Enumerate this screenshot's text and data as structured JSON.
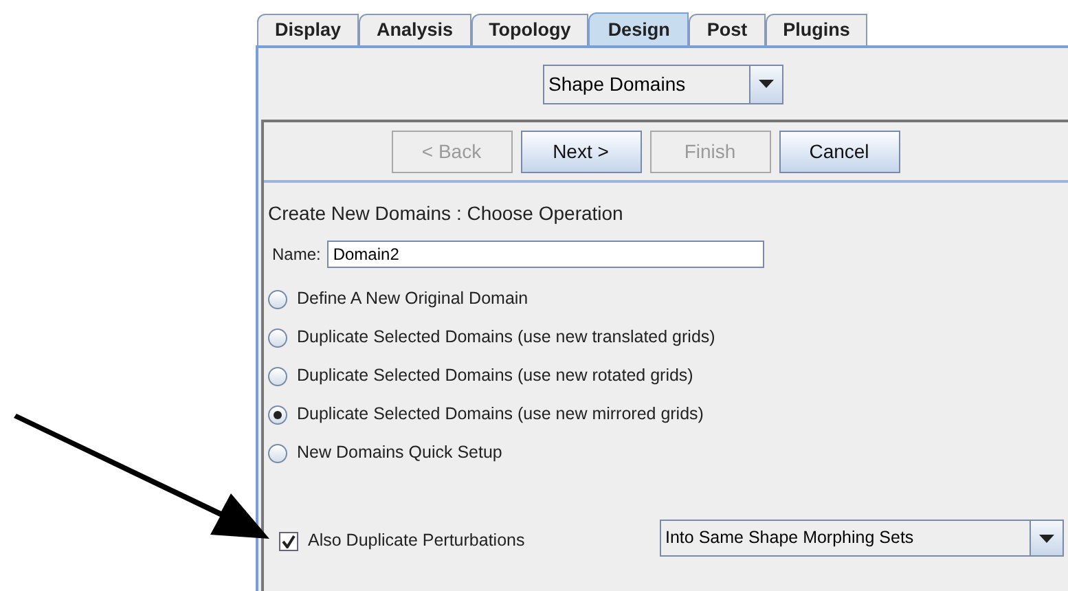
{
  "tabs": [
    {
      "label": "Display",
      "selected": false
    },
    {
      "label": "Analysis",
      "selected": false
    },
    {
      "label": "Topology",
      "selected": false
    },
    {
      "label": "Design",
      "selected": true
    },
    {
      "label": "Post",
      "selected": false
    },
    {
      "label": "Plugins",
      "selected": false
    }
  ],
  "mode_select": {
    "value": "Shape Domains"
  },
  "wizard_buttons": [
    {
      "label": "< Back",
      "disabled": true
    },
    {
      "label": "Next >",
      "disabled": false
    },
    {
      "label": "Finish",
      "disabled": true
    },
    {
      "label": "Cancel",
      "disabled": false
    }
  ],
  "heading": "Create New Domains : Choose Operation",
  "name_field": {
    "label": "Name:",
    "value": "Domain2"
  },
  "options": [
    {
      "label": "Define A New Original Domain",
      "selected": false
    },
    {
      "label": "Duplicate Selected Domains (use new translated grids)",
      "selected": false
    },
    {
      "label": "Duplicate Selected Domains (use new rotated grids)",
      "selected": false
    },
    {
      "label": "Duplicate Selected Domains (use new mirrored grids)",
      "selected": true
    },
    {
      "label": "New Domains Quick Setup",
      "selected": false
    }
  ],
  "perturbations": {
    "label": "Also Duplicate Perturbations",
    "checked": true
  },
  "target_select": {
    "value": "Into Same Shape Morphing Sets"
  }
}
